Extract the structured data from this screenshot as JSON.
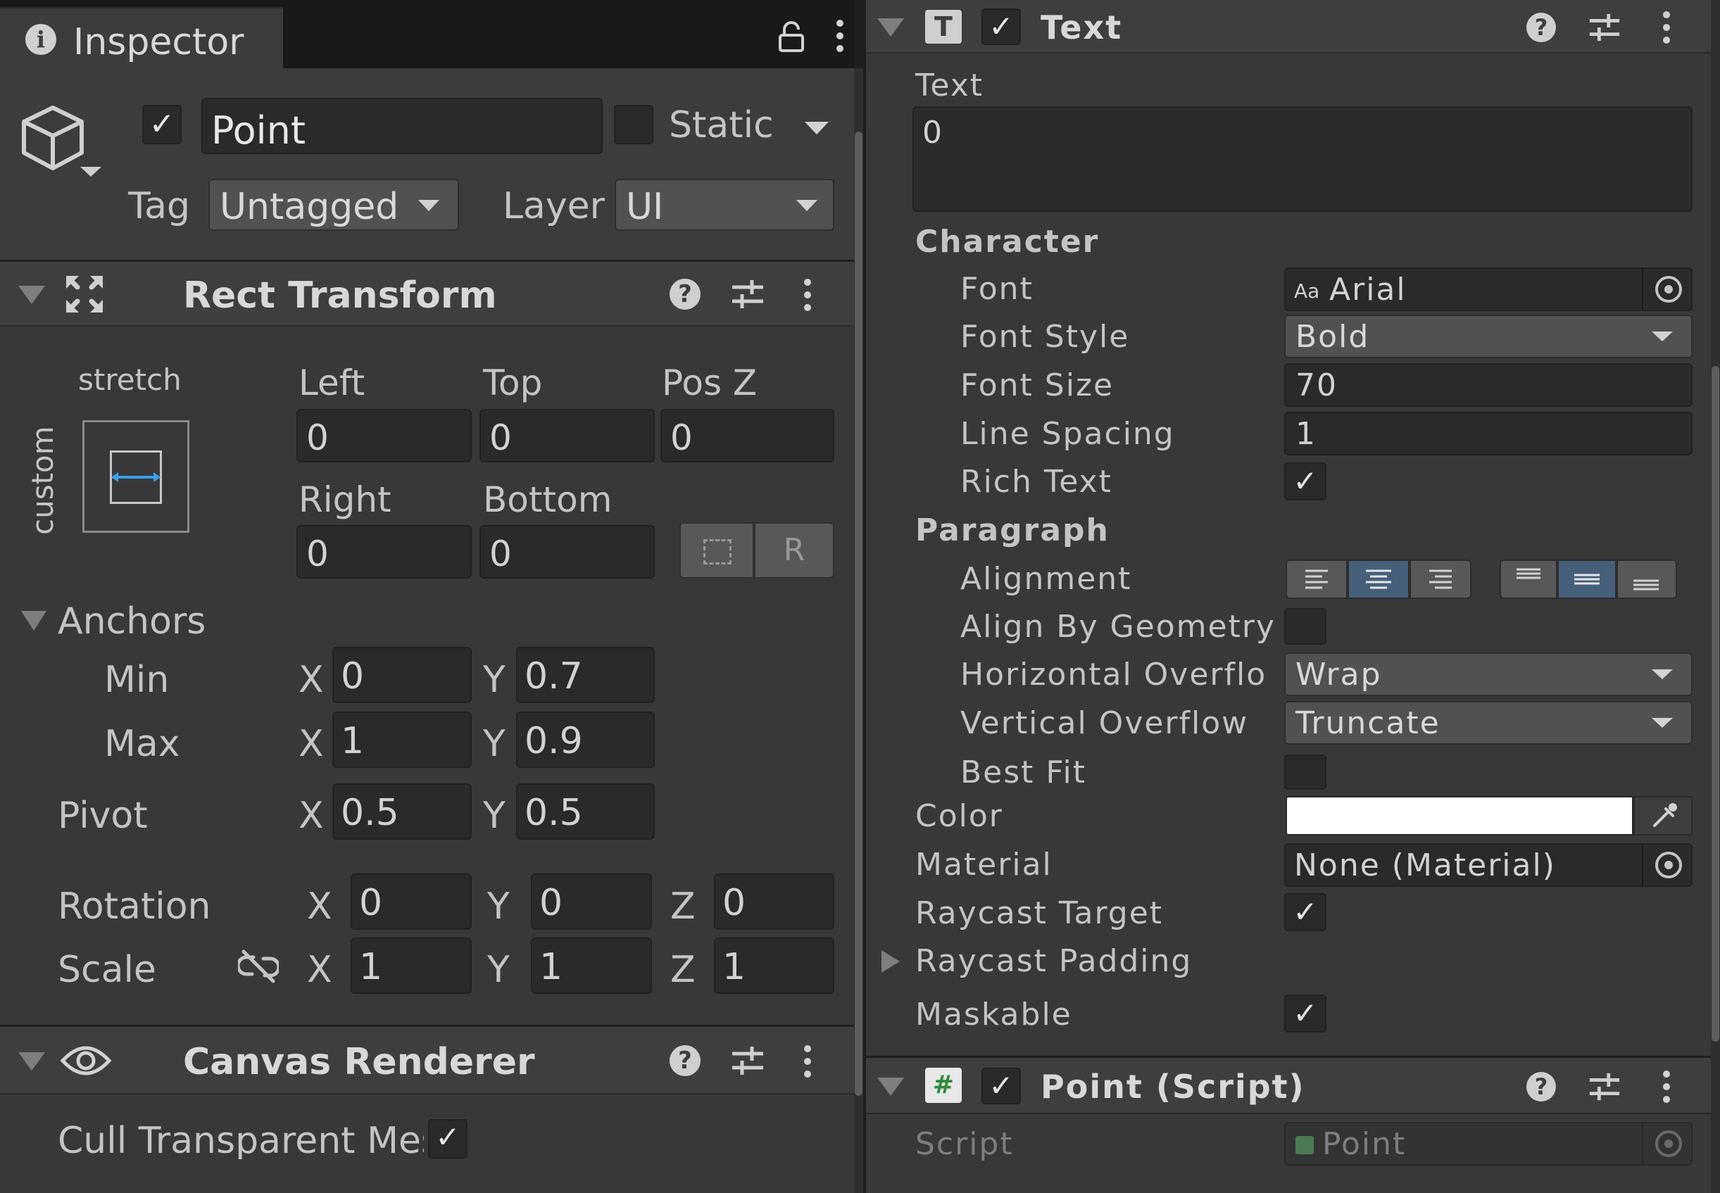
{
  "tab": {
    "title": "Inspector"
  },
  "gameobject": {
    "name": "Point",
    "static_label": "Static",
    "tag_label": "Tag",
    "tag_value": "Untagged",
    "layer_label": "Layer",
    "layer_value": "UI"
  },
  "rect_transform": {
    "title": "Rect Transform",
    "anchor_preset_horizontal": "stretch",
    "anchor_preset_vertical": "custom",
    "left_label": "Left",
    "top_label": "Top",
    "posz_label": "Pos Z",
    "left": "0",
    "top": "0",
    "posz": "0",
    "right_label": "Right",
    "bottom_label": "Bottom",
    "right": "0",
    "bottom": "0",
    "raw_button": "R",
    "anchors_label": "Anchors",
    "min_label": "Min",
    "max_label": "Max",
    "pivot_label": "Pivot",
    "x": "X",
    "y": "Y",
    "z": "Z",
    "min_x": "0",
    "min_y": "0.7",
    "max_x": "1",
    "max_y": "0.9",
    "pivot_x": "0.5",
    "pivot_y": "0.5",
    "rotation_label": "Rotation",
    "rot_x": "0",
    "rot_y": "0",
    "rot_z": "0",
    "scale_label": "Scale",
    "scale_x": "1",
    "scale_y": "1",
    "scale_z": "1"
  },
  "canvas_renderer": {
    "title": "Canvas Renderer",
    "cull_label": "Cull Transparent Mes",
    "cull_checked": true
  },
  "text_component": {
    "title": "Text",
    "text_label": "Text",
    "text_value": "0",
    "character_header": "Character",
    "font_label": "Font",
    "font_value": "Arial",
    "font_prefix": "Aa",
    "font_style_label": "Font Style",
    "font_style_value": "Bold",
    "font_size_label": "Font Size",
    "font_size_value": "70",
    "line_spacing_label": "Line Spacing",
    "line_spacing_value": "1",
    "rich_text_label": "Rich Text",
    "paragraph_header": "Paragraph",
    "alignment_label": "Alignment",
    "align_geometry_label": "Align By Geometry",
    "h_overflow_label": "Horizontal Overflo",
    "h_overflow_value": "Wrap",
    "v_overflow_label": "Vertical Overflow",
    "v_overflow_value": "Truncate",
    "best_fit_label": "Best Fit",
    "color_label": "Color",
    "color_value": "#ffffff",
    "material_label": "Material",
    "material_value": "None (Material)",
    "raycast_target_label": "Raycast Target",
    "raycast_padding_label": "Raycast Padding",
    "maskable_label": "Maskable"
  },
  "point_script": {
    "title": "Point (Script)",
    "script_label": "Script",
    "script_value": "Point"
  },
  "checkmark": "✓"
}
